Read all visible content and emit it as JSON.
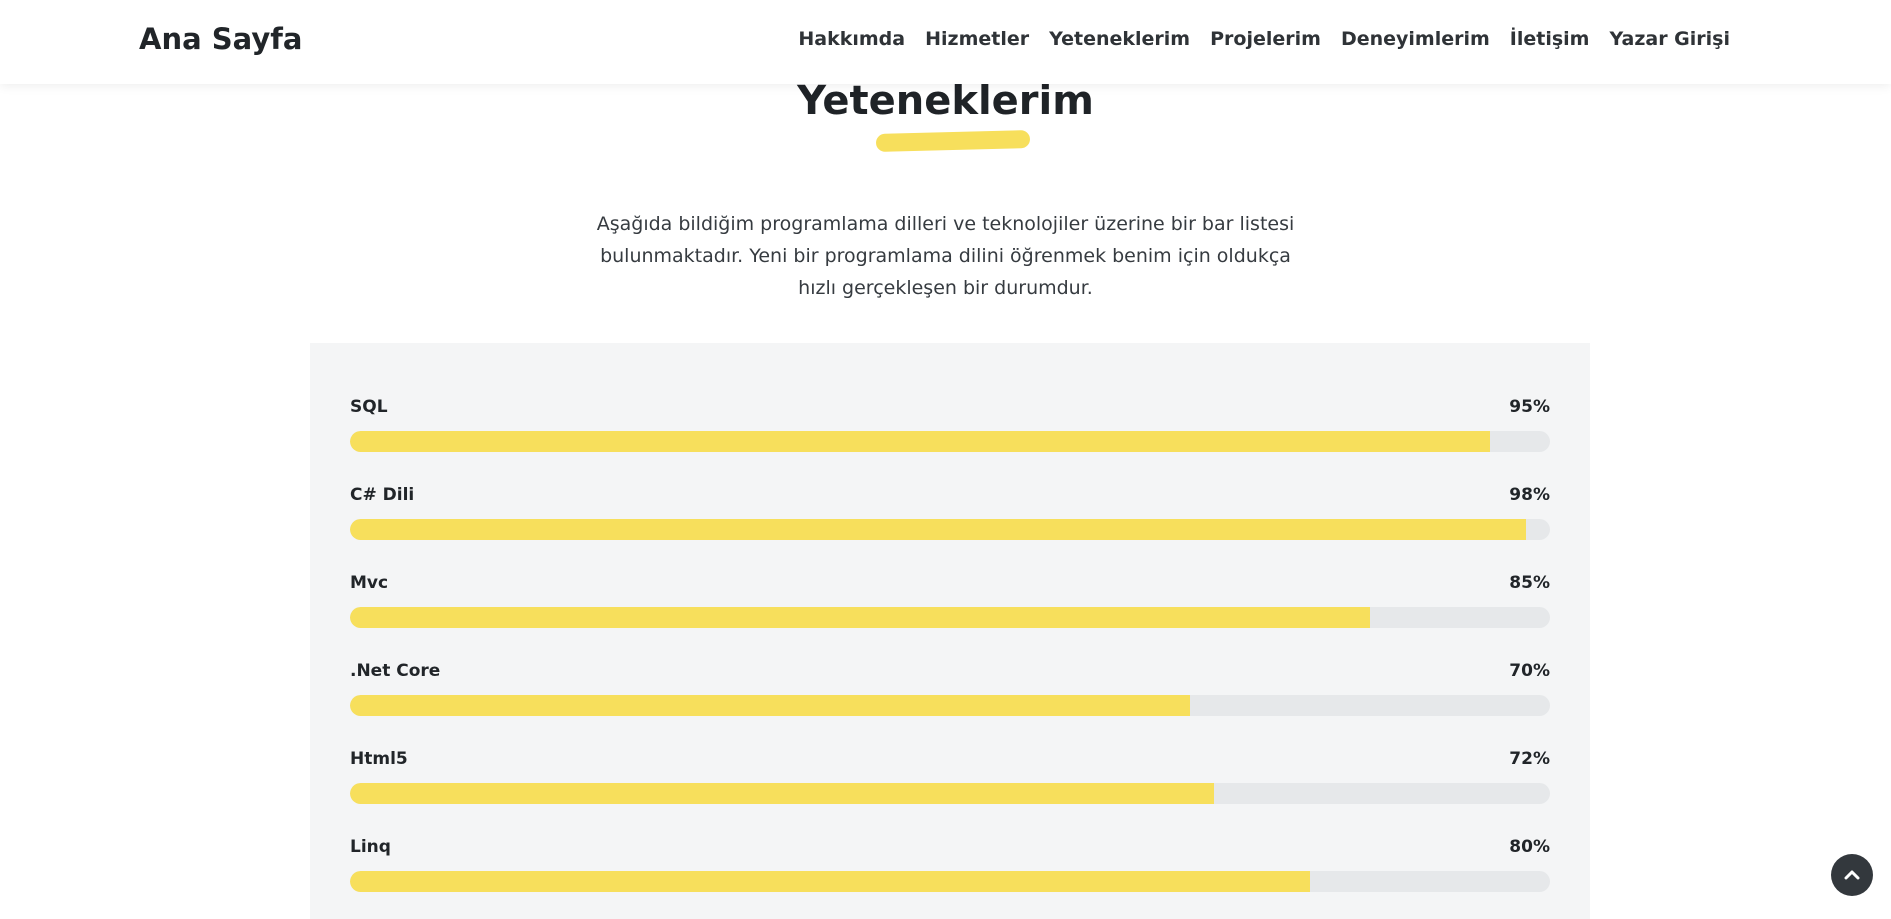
{
  "nav": {
    "brand": "Ana Sayfa",
    "links": [
      "Hakkımda",
      "Hizmetler",
      "Yeteneklerim",
      "Projelerim",
      "Deneyimlerim",
      "İletişim",
      "Yazar Girişi"
    ]
  },
  "section": {
    "title": "Yeteneklerim",
    "intro": "Aşağıda bildiğim programlama dilleri ve teknolojiler üzerine bir bar listesi bulunmaktadır. Yeni bir programlama dilini öğrenmek benim için oldukça hızlı gerçekleşen bir durumdur."
  },
  "skills": [
    {
      "name": "SQL",
      "percent_label": "95%",
      "value": 95
    },
    {
      "name": "C# Dili",
      "percent_label": "98%",
      "value": 98
    },
    {
      "name": "Mvc",
      "percent_label": "85%",
      "value": 85
    },
    {
      "name": ".Net Core",
      "percent_label": "70%",
      "value": 70
    },
    {
      "name": "Html5",
      "percent_label": "72%",
      "value": 72
    },
    {
      "name": "Linq",
      "percent_label": "80%",
      "value": 80
    }
  ],
  "icons": {
    "scroll_top": "chevron-up-icon"
  },
  "colors": {
    "accent": "#f7df5c",
    "track": "#e6e8ea",
    "panel": "#f4f5f6",
    "scroll_button": "#33383d"
  }
}
